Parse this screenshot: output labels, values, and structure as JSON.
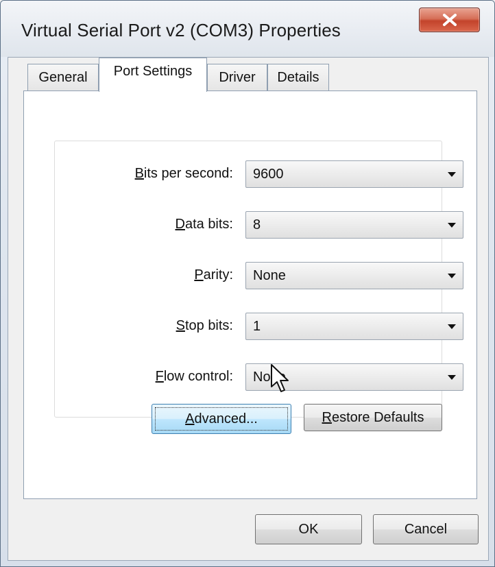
{
  "window": {
    "title": "Virtual Serial Port v2 (COM3) Properties"
  },
  "tabs": [
    {
      "label": "General",
      "active": false
    },
    {
      "label": "Port Settings",
      "active": true
    },
    {
      "label": "Driver",
      "active": false
    },
    {
      "label": "Details",
      "active": false
    }
  ],
  "settings": {
    "bits_per_second": {
      "label_accel": "B",
      "label_rest": "its per second:",
      "value": "9600"
    },
    "data_bits": {
      "label_accel": "D",
      "label_rest": "ata bits:",
      "value": "8"
    },
    "parity": {
      "label_accel": "P",
      "label_rest": "arity:",
      "value": "None"
    },
    "stop_bits": {
      "label_accel": "S",
      "label_rest": "top bits:",
      "value": "1"
    },
    "flow_control": {
      "label_accel": "F",
      "label_rest": "low control:",
      "value": "None"
    }
  },
  "buttons": {
    "advanced": {
      "accel": "A",
      "rest": "dvanced..."
    },
    "restore_defaults": {
      "accel": "R",
      "rest": "estore Defaults"
    },
    "ok": "OK",
    "cancel": "Cancel"
  },
  "icons": {
    "close": "close-icon",
    "dropdown": "chevron-down-icon",
    "cursor": "mouse-pointer-icon"
  },
  "colors": {
    "close_button": "#c3432b",
    "focus_button": "#bee6fd",
    "panel": "#ffffff"
  }
}
